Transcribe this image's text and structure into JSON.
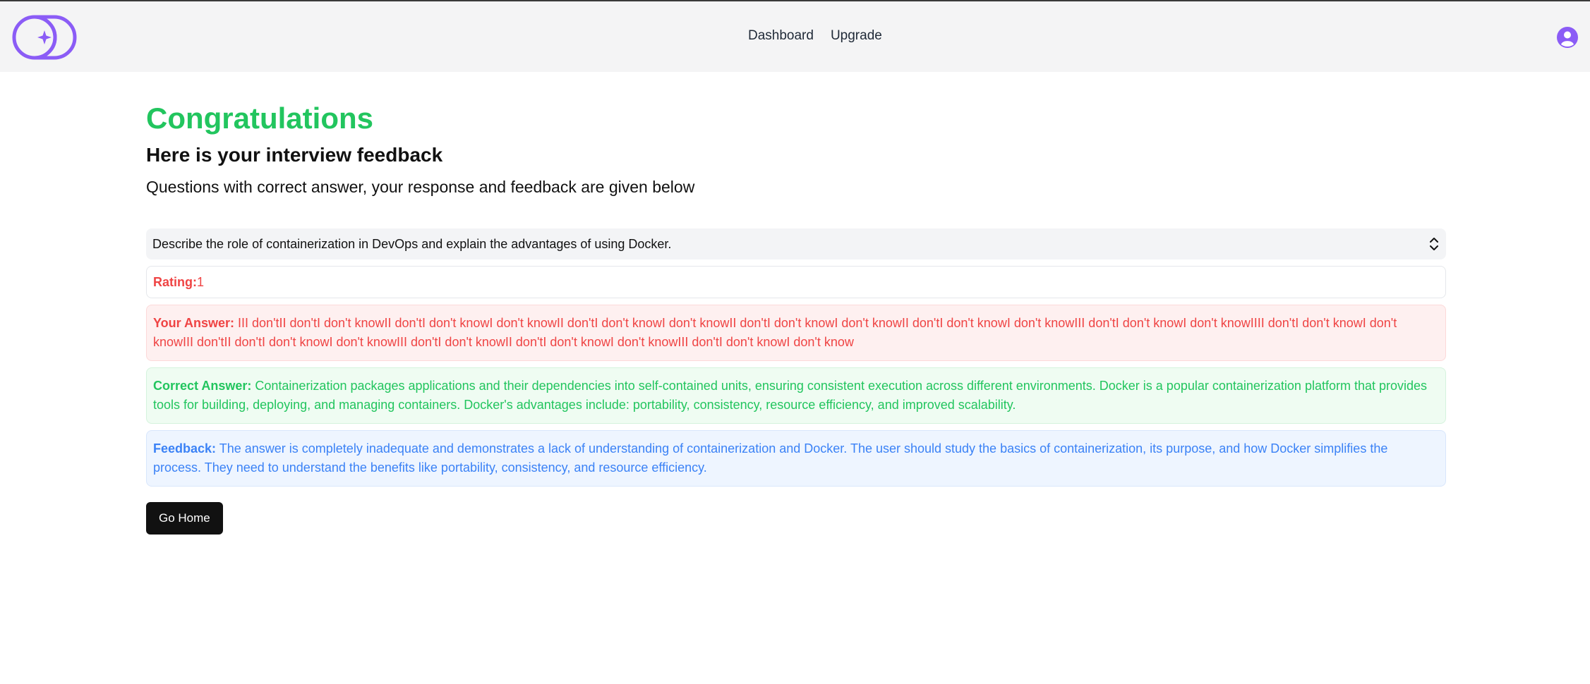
{
  "nav": {
    "dashboard": "Dashboard",
    "upgrade": "Upgrade"
  },
  "colors": {
    "brand": "#8b5cf6",
    "success": "#22c55e",
    "danger": "#ef4444",
    "info": "#3b82f6"
  },
  "page": {
    "title": "Congratulations",
    "subtitle": "Here is your interview feedback",
    "description": "Questions with correct answer, your response and feedback are given below"
  },
  "question": {
    "text": "Describe the role of containerization in DevOps and explain the advantages of using Docker.",
    "icon": "chevron-up-down-icon"
  },
  "rating": {
    "label": "Rating:",
    "value": "1"
  },
  "your_answer": {
    "label": "Your Answer:",
    "text": "III don'tII don'tI don't knowII don'tI don't knowI don't knowII don'tI don't knowI don't knowII don'tI don't knowI don't knowII don'tI don't knowI don't knowIII don'tI don't knowI don't knowIIII don'tI don't knowI don't knowIII don'tII don'tI don't knowI don't knowIII don'tI don't knowII don'tI don't knowI don't knowIII don'tI don't knowI don't know"
  },
  "correct_answer": {
    "label": "Correct Answer:",
    "text": "Containerization packages applications and their dependencies into self-contained units, ensuring consistent execution across different environments. Docker is a popular containerization platform that provides tools for building, deploying, and managing containers. Docker's advantages include: portability, consistency, resource efficiency, and improved scalability."
  },
  "feedback": {
    "label": "Feedback:",
    "text": "The answer is completely inadequate and demonstrates a lack of understanding of containerization and Docker. The user should study the basics of containerization, its purpose, and how Docker simplifies the process. They need to understand the benefits like portability, consistency, and resource efficiency."
  },
  "actions": {
    "go_home": "Go Home"
  }
}
